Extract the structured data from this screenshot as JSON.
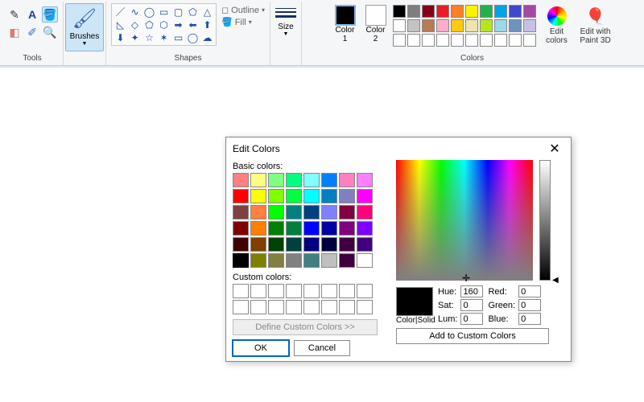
{
  "ribbon": {
    "groups": {
      "tools": {
        "label": "Tools"
      },
      "brushes": {
        "label": "Brushes"
      },
      "shapes": {
        "label": "Shapes",
        "outline": "Outline",
        "fill": "Fill"
      },
      "size": {
        "label": "Size"
      },
      "colors": {
        "label": "Colors",
        "color1": "Color\n1",
        "color2": "Color\n2",
        "edit": "Edit\ncolors",
        "p3d": "Edit with\nPaint 3D"
      }
    },
    "palette": [
      "#000000",
      "#7f7f7f",
      "#880015",
      "#ed1c24",
      "#ff7f27",
      "#fff200",
      "#22b14c",
      "#00a2e8",
      "#3f48cc",
      "#a349a4",
      "#ffffff",
      "#c3c3c3",
      "#b97a57",
      "#ffaec9",
      "#ffc90e",
      "#efe4b0",
      "#b5e61d",
      "#99d9ea",
      "#7092be",
      "#c8bfe7",
      "#ffffff",
      "#ffffff",
      "#ffffff",
      "#ffffff",
      "#ffffff",
      "#ffffff",
      "#ffffff",
      "#ffffff",
      "#ffffff",
      "#ffffff"
    ]
  },
  "dialog": {
    "title": "Edit Colors",
    "basic_label": "Basic colors:",
    "custom_label": "Custom colors:",
    "define": "Define Custom Colors >>",
    "ok": "OK",
    "cancel": "Cancel",
    "color_solid": "Color|Solid",
    "add": "Add to Custom Colors",
    "hsv": {
      "hue_label": "Hue:",
      "hue": "160",
      "sat_label": "Sat:",
      "sat": "0",
      "lum_label": "Lum:",
      "lum": "0",
      "red_label": "Red:",
      "red": "0",
      "green_label": "Green:",
      "green": "0",
      "blue_label": "Blue:",
      "blue": "0"
    },
    "basic_colors": [
      "#ff8080",
      "#ffff80",
      "#80ff80",
      "#00ff80",
      "#80ffff",
      "#0080ff",
      "#ff80c0",
      "#ff80ff",
      "#ff0000",
      "#ffff00",
      "#80ff00",
      "#00ff40",
      "#00ffff",
      "#0080c0",
      "#8080c0",
      "#ff00ff",
      "#804040",
      "#ff8040",
      "#00ff00",
      "#008080",
      "#004080",
      "#8080ff",
      "#800040",
      "#ff0080",
      "#800000",
      "#ff8000",
      "#008000",
      "#008040",
      "#0000ff",
      "#0000a0",
      "#800080",
      "#8000ff",
      "#400000",
      "#804000",
      "#004000",
      "#004040",
      "#000080",
      "#000040",
      "#400040",
      "#400080",
      "#000000",
      "#808000",
      "#808040",
      "#808080",
      "#408080",
      "#c0c0c0",
      "#400040",
      "#ffffff"
    ],
    "selected_basic_index": 40
  }
}
